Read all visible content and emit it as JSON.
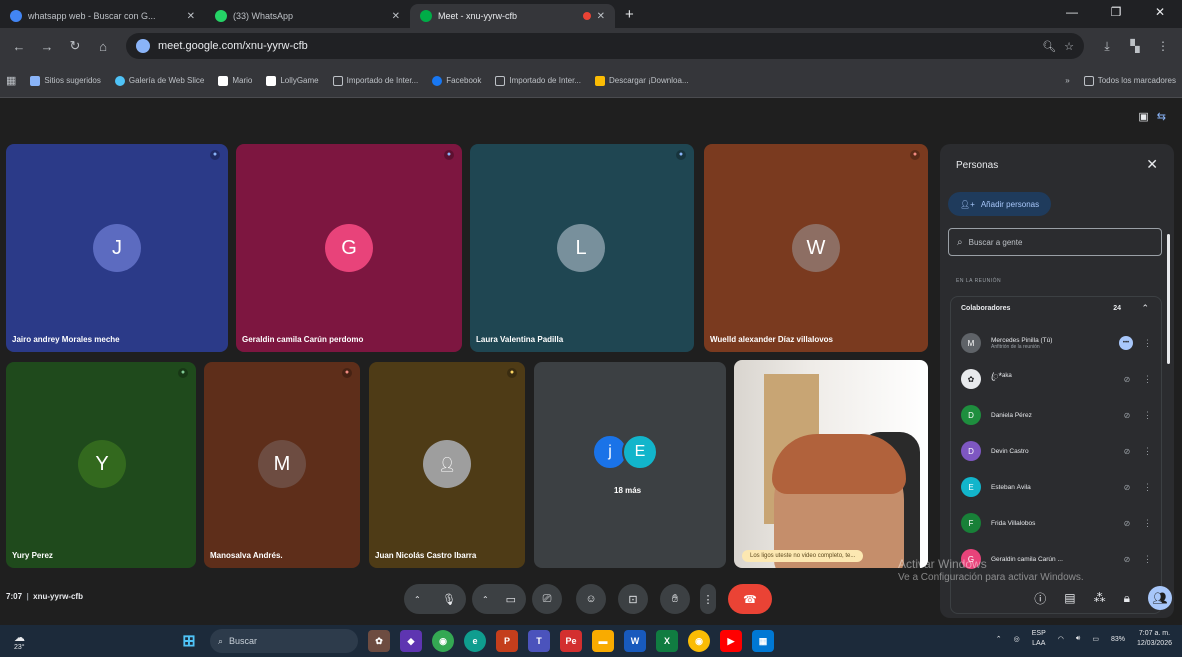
{
  "browser": {
    "tabs": [
      {
        "title": "whatsapp web - Buscar con G...",
        "favicon_color": "#4285f4",
        "active": false
      },
      {
        "title": "(33) WhatsApp",
        "favicon_color": "#25d366",
        "active": false
      },
      {
        "title": "Meet - xnu-yyrw-cfb",
        "favicon_color": "#00ac47",
        "active": true
      }
    ],
    "url": "meet.google.com/xnu-yyrw-cfb",
    "bookmarks": [
      {
        "label": "Sitios sugeridos",
        "color": "#8ab4f8",
        "type": "link"
      },
      {
        "label": "Galería de Web Slice",
        "color": "#4fc3f7",
        "type": "link"
      },
      {
        "label": "Mario",
        "color": "#ffffff",
        "type": "link"
      },
      {
        "label": "LollyGame",
        "color": "#ffffff",
        "type": "link"
      },
      {
        "label": "Importado de Inter...",
        "color": "#bdc1c6",
        "type": "folder"
      },
      {
        "label": "Facebook",
        "color": "#1877f2",
        "type": "link"
      },
      {
        "label": "Importado de Inter...",
        "color": "#bdc1c6",
        "type": "folder"
      },
      {
        "label": "Descargar ¡Downloa...",
        "color": "#fbbc04",
        "type": "link"
      }
    ],
    "all_bookmarks": "Todos los marcadores"
  },
  "meet": {
    "tiles": [
      {
        "initial": "J",
        "name": "Jairo andrey Morales meche",
        "bg": "#2b3a88",
        "avatar": "#5c6bc0"
      },
      {
        "initial": "G",
        "name": "Geraldin camila Carún perdomo",
        "bg": "#7d1640",
        "avatar": "#e8437a"
      },
      {
        "initial": "L",
        "name": "Laura Valentina Padilla",
        "bg": "#1f4652",
        "avatar": "#78909c"
      },
      {
        "initial": "W",
        "name": "Wuelld alexander Díaz villalovos",
        "bg": "#7a3a1f",
        "avatar": "#8d6e63"
      },
      {
        "initial": "Y",
        "name": "Yury Perez",
        "bg": "#1f4a1c",
        "avatar": "#33691e"
      },
      {
        "initial": "M",
        "name": "Manosalva Andrés.",
        "bg": "#5e2e1a",
        "avatar": "#6d4c41"
      },
      {
        "initial": "",
        "name": "Juan Nicolás Castro Ibarra",
        "bg": "#4e3b16",
        "avatar": "#9e9e9e"
      }
    ],
    "more": {
      "initials": [
        "j",
        "E"
      ],
      "label": "18 más"
    },
    "selfview_caption": "Los ligos uteste no video completo, te...",
    "meeting_time": "7:07",
    "meeting_code": "xnu-yyrw-cfb",
    "watermark": [
      "Activar Windows",
      "Ve a Configuración para activar Windows."
    ]
  },
  "people_panel": {
    "title": "Personas",
    "add_label": "Añadir personas",
    "search_placeholder": "Buscar a gente",
    "section_label": "EN LA REUNIÓN",
    "group_name": "Colaboradores",
    "group_count": "24",
    "people": [
      {
        "initial": "M",
        "name": "Mercedes Pinilla (Tú)",
        "sub": "Anfitrión de la reunión",
        "color": "#5f6368",
        "speaking": true
      },
      {
        "initial": "✿",
        "name": "ꦿ*ᵃᵏᵃ",
        "sub": "",
        "color": "#9e9e9e",
        "speaking": false
      },
      {
        "initial": "D",
        "name": "Daniela Pérez",
        "sub": "",
        "color": "#1e8e3e",
        "speaking": false
      },
      {
        "initial": "D",
        "name": "Devin Castro",
        "sub": "",
        "color": "#7e57c2",
        "speaking": false
      },
      {
        "initial": "E",
        "name": "Esteban Ávila",
        "sub": "",
        "color": "#12b5cb",
        "speaking": false
      },
      {
        "initial": "F",
        "name": "Frida Villalobos",
        "sub": "",
        "color": "#188038",
        "speaking": false
      },
      {
        "initial": "G",
        "name": "Geraldin camila Carún ...",
        "sub": "",
        "color": "#e8437a",
        "speaking": false
      }
    ]
  },
  "taskbar": {
    "weather": "23°",
    "search_label": "Buscar",
    "language": [
      "ESP",
      "LAA"
    ],
    "battery": "83%",
    "time": "7:07 a. m.",
    "date": "12/03/2026"
  }
}
